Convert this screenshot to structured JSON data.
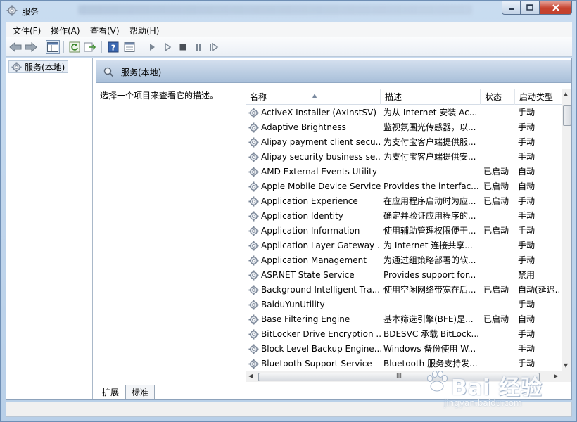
{
  "window": {
    "title": "服务"
  },
  "menu": [
    {
      "label": "文件(F)"
    },
    {
      "label": "操作(A)"
    },
    {
      "label": "查看(V)"
    },
    {
      "label": "帮助(H)"
    }
  ],
  "tree": {
    "root_label": "服务(本地)"
  },
  "main": {
    "header_title": "服务(本地)",
    "description_prompt": "选择一个项目来查看它的描述。"
  },
  "columns": {
    "name": "名称",
    "desc": "描述",
    "status": "状态",
    "startup": "启动类型"
  },
  "rows": [
    {
      "name": "ActiveX Installer (AxInstSV)",
      "desc": "为从 Internet 安装 Ac...",
      "status": "",
      "startup": "手动"
    },
    {
      "name": "Adaptive Brightness",
      "desc": "监视氛围光传感器，以...",
      "status": "",
      "startup": "手动"
    },
    {
      "name": "Alipay payment client secu...",
      "desc": "为支付宝客户端提供服...",
      "status": "",
      "startup": "手动"
    },
    {
      "name": "Alipay security business se...",
      "desc": "为支付宝客户端提供安...",
      "status": "",
      "startup": "手动"
    },
    {
      "name": "AMD External Events Utility",
      "desc": "",
      "status": "已启动",
      "startup": "自动"
    },
    {
      "name": "Apple Mobile Device Service",
      "desc": "Provides the interfac...",
      "status": "已启动",
      "startup": "自动"
    },
    {
      "name": "Application Experience",
      "desc": "在应用程序启动时为应...",
      "status": "已启动",
      "startup": "手动"
    },
    {
      "name": "Application Identity",
      "desc": "确定并验证应用程序的...",
      "status": "",
      "startup": "手动"
    },
    {
      "name": "Application Information",
      "desc": "使用辅助管理权限便于...",
      "status": "已启动",
      "startup": "手动"
    },
    {
      "name": "Application Layer Gateway ...",
      "desc": "为 Internet 连接共享...",
      "status": "",
      "startup": "手动"
    },
    {
      "name": "Application Management",
      "desc": "为通过组策略部署的软...",
      "status": "",
      "startup": "手动"
    },
    {
      "name": "ASP.NET State Service",
      "desc": "Provides support for...",
      "status": "",
      "startup": "禁用"
    },
    {
      "name": "Background Intelligent Tra...",
      "desc": "使用空闲网络带宽在后...",
      "status": "已启动",
      "startup": "自动(延迟..."
    },
    {
      "name": "BaiduYunUtility",
      "desc": "",
      "status": "",
      "startup": "手动"
    },
    {
      "name": "Base Filtering Engine",
      "desc": "基本筛选引擎(BFE)是...",
      "status": "已启动",
      "startup": "自动"
    },
    {
      "name": "BitLocker Drive Encryption ...",
      "desc": "BDESVC 承载 BitLock...",
      "status": "",
      "startup": "手动"
    },
    {
      "name": "Block Level Backup Engine...",
      "desc": "Windows 备份使用 W...",
      "status": "",
      "startup": "手动"
    },
    {
      "name": "Bluetooth Support Service",
      "desc": "Bluetooth 服务支持发...",
      "status": "",
      "startup": "手动"
    }
  ],
  "tabs": [
    {
      "label": "扩展"
    },
    {
      "label": "标准"
    }
  ],
  "scroll": {
    "h_thumb_glyph": "III"
  },
  "watermark": {
    "brand": "Bai 经验",
    "sub": "jingyan.baidu.com"
  },
  "icons": {
    "title": "gear-icon",
    "service": "gear-icon"
  }
}
